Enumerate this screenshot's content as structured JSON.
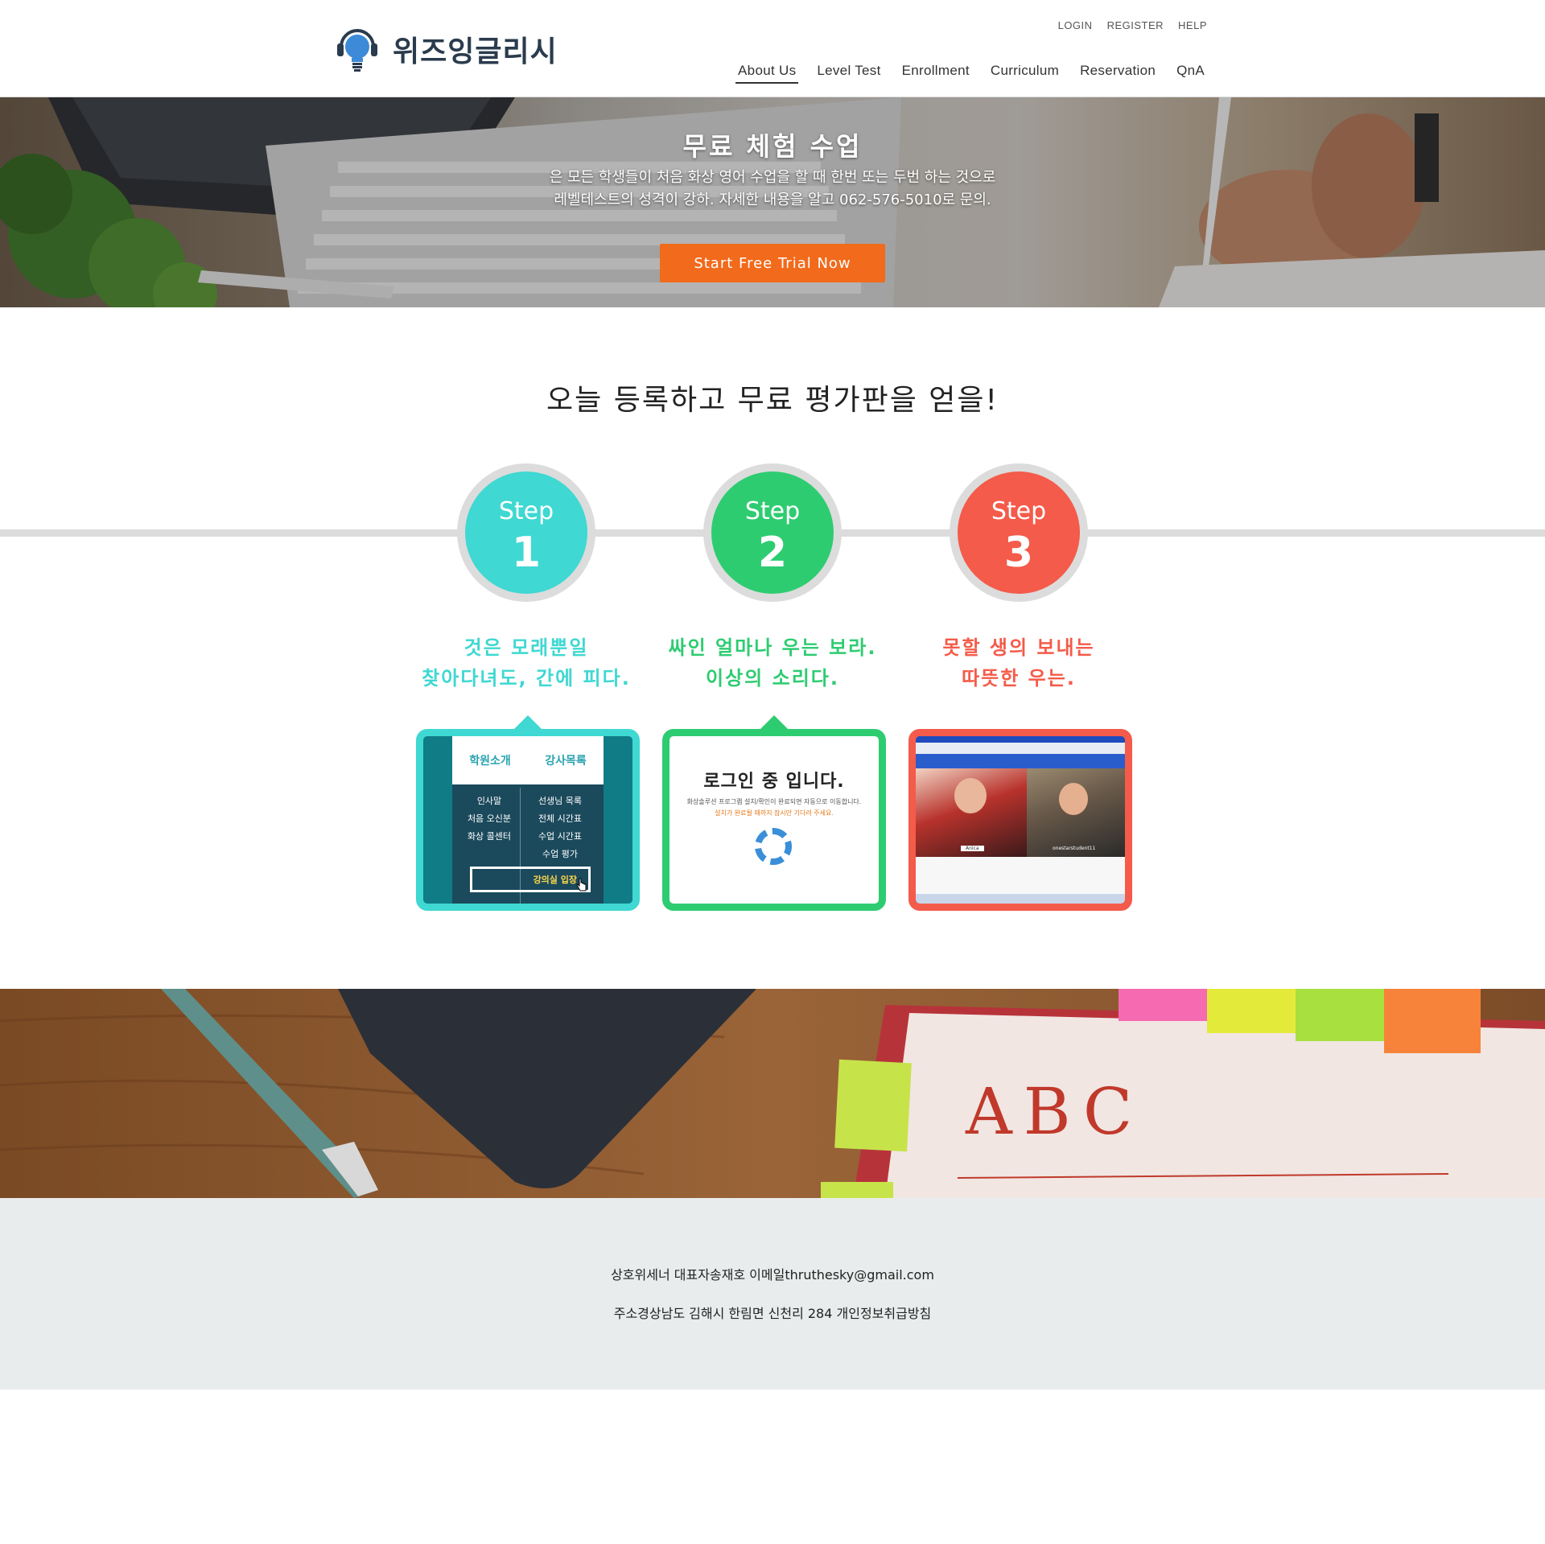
{
  "brand": {
    "name": "위즈잉글리시",
    "logo_icon": "lightbulb-headset-icon"
  },
  "util_nav": [
    "LOGIN",
    "REGISTER",
    "HELP"
  ],
  "main_nav": [
    {
      "label": "About Us",
      "active": true
    },
    {
      "label": "Level Test",
      "active": false
    },
    {
      "label": "Enrollment",
      "active": false
    },
    {
      "label": "Curriculum",
      "active": false
    },
    {
      "label": "Reservation",
      "active": false
    },
    {
      "label": "QnA",
      "active": false
    }
  ],
  "hero": {
    "title": "무료 체험 수업",
    "line1": "은 모든 학생들이 처음 화상 영어 수업을 할 때 한번 또는 두번 하는 것으로",
    "line2": "레벨테스트의 성격이 강하. 자세한 내용을 알고 062-576-5010로 문의.",
    "button": "Start Free Trial Now",
    "button_color": "#f26a1b"
  },
  "steps_section": {
    "title": "오늘 등록하고 무료 평가판을 얻을!",
    "steps": [
      {
        "label": "Step",
        "number": "1",
        "color": "#3fd8d2",
        "line1": "것은 모래뿐일",
        "line2": "찾아다녀도, 간에 피다."
      },
      {
        "label": "Step",
        "number": "2",
        "color": "#2ecc71",
        "line1": "싸인 얼마나 우는 보라.",
        "line2": "이상의 소리다."
      },
      {
        "label": "Step",
        "number": "3",
        "color": "#f45b4a",
        "line1": "못할 생의 보내는",
        "line2": "따뜻한 우는."
      }
    ]
  },
  "card1": {
    "tab1": "학원소개",
    "tab2": "강사목록",
    "left_items": [
      "인사말",
      "처음 오신분",
      "화상 콜센터"
    ],
    "right_items": [
      "선생님 목록",
      "전체 시간표",
      "수업 시간표",
      "수업 평가"
    ],
    "highlight": "강의실 입장"
  },
  "card2": {
    "title": "로그인 중 입니다.",
    "sub1": "화상솔루션 프로그램 설치/확인이 완료되면 자동으로 이동합니다.",
    "sub2": "설치가 완료될 때까지 잠시만 기다려 주세요."
  },
  "card3": {
    "name1": "Anica",
    "name2": "onestarstudent11"
  },
  "footer": {
    "line1": "상호위세너 대표자송재호 이메일thruthesky@gmail.com",
    "line2": "주소경상남도 김해시 한림면 신천리 284 개인정보취급방침"
  }
}
